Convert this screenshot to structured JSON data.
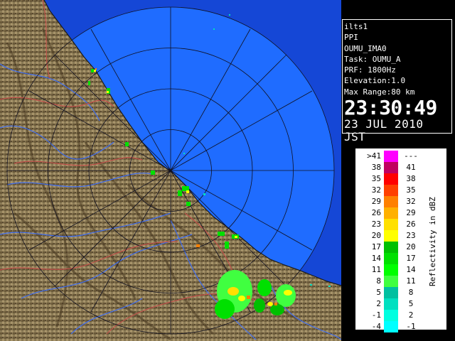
{
  "info": {
    "lines": [
      "ilts1",
      "PPI",
      "OUMU_IMA0",
      "Task: OUMU_A",
      "PRF: 1800Hz",
      "Elevation:1.0",
      "Max Range:80 km"
    ],
    "time": "23:30:49",
    "date": "23 JUL 2010 JST"
  },
  "legend": {
    "title": "Reflectivity in dBZ",
    "rows": [
      {
        "left": ">41",
        "right": "---",
        "color": "#ff00ff"
      },
      {
        "left": "38",
        "right": "41",
        "color": "#c00060"
      },
      {
        "left": "35",
        "right": "38",
        "color": "#ff0000"
      },
      {
        "left": "32",
        "right": "35",
        "color": "#ff4000"
      },
      {
        "left": "29",
        "right": "32",
        "color": "#ff8000"
      },
      {
        "left": "26",
        "right": "29",
        "color": "#ffb000"
      },
      {
        "left": "23",
        "right": "26",
        "color": "#ffe000"
      },
      {
        "left": "20",
        "right": "23",
        "color": "#ffff00"
      },
      {
        "left": "17",
        "right": "20",
        "color": "#00c000"
      },
      {
        "left": "14",
        "right": "17",
        "color": "#00e000"
      },
      {
        "left": "11",
        "right": "14",
        "color": "#00ff00"
      },
      {
        "left": "8",
        "right": "11",
        "color": "#40ff40"
      },
      {
        "left": "5",
        "right": "8",
        "color": "#00c0a0"
      },
      {
        "left": "2",
        "right": "5",
        "color": "#00e0c0"
      },
      {
        "left": "-1",
        "right": "2",
        "color": "#00ffe0"
      },
      {
        "left": "-4",
        "right": "-1",
        "color": "#00ffff"
      }
    ]
  },
  "colors": {
    "sea": "#1f6cff",
    "sea_outer": "#1547d6",
    "land": "#8a7a55",
    "river": "#3f6df0",
    "border": "#c0504a"
  }
}
